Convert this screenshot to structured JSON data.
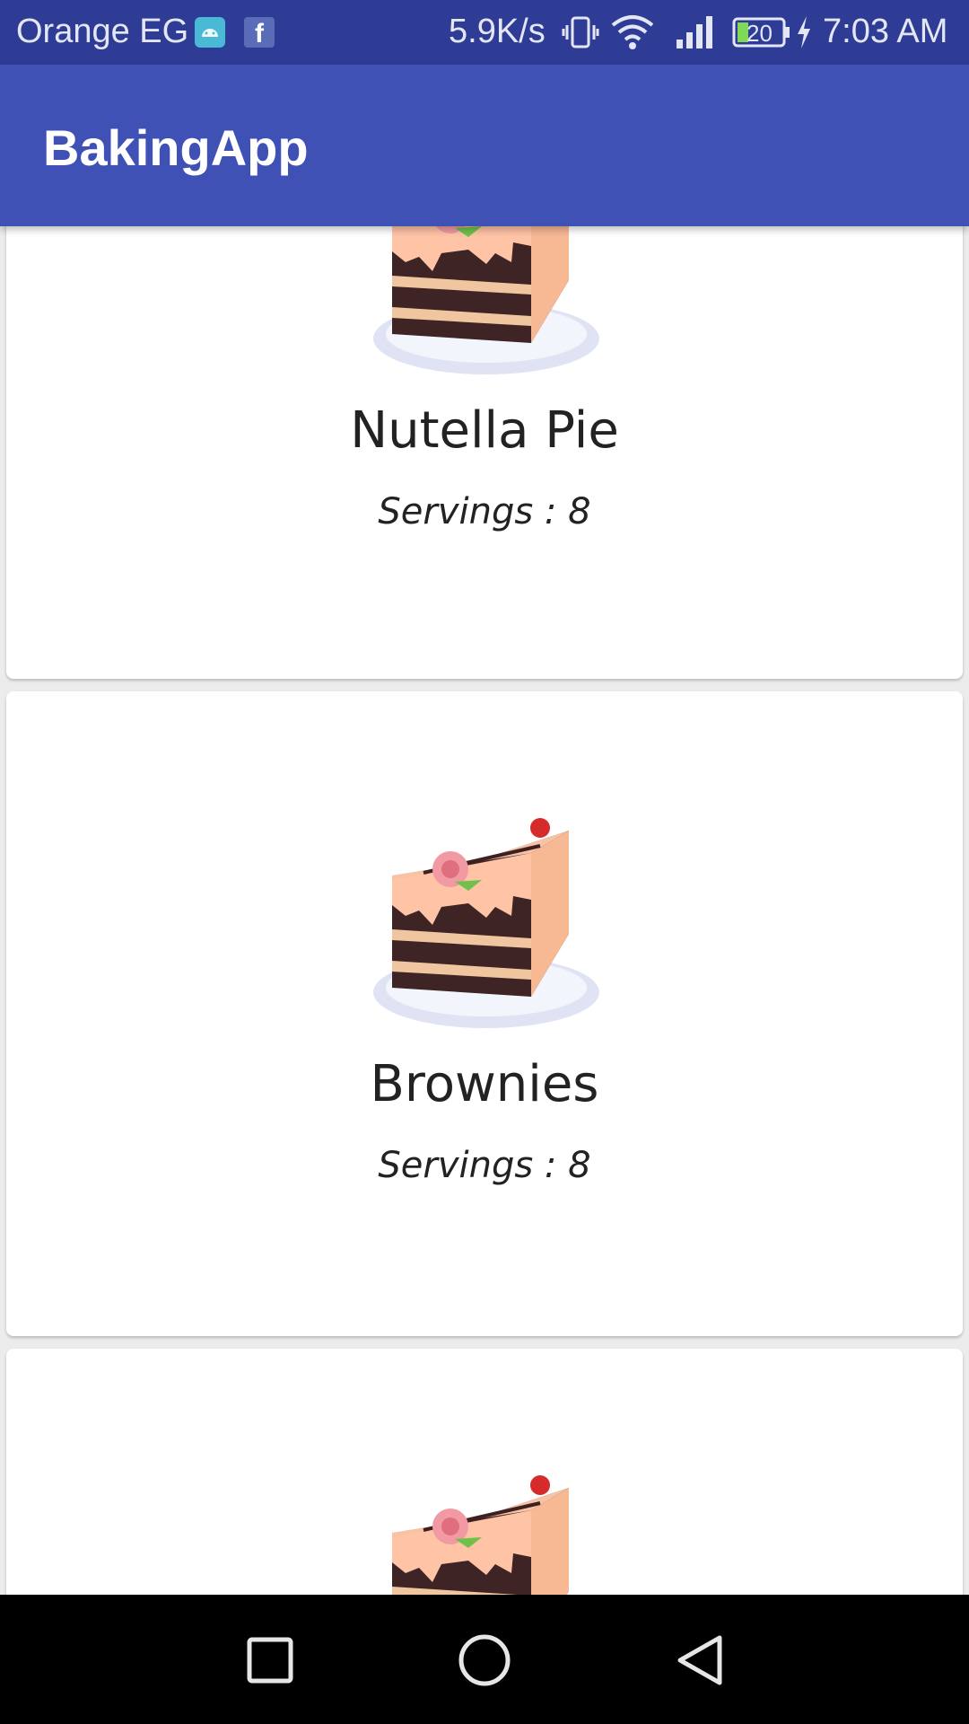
{
  "status_bar": {
    "carrier": "Orange EG",
    "network_speed": "5.9K/s",
    "battery_level": "20",
    "time": "7:03 AM",
    "icons": [
      "android-notification-icon",
      "facebook-notification-icon",
      "vibrate-icon",
      "wifi-icon",
      "signal-icon",
      "battery-icon",
      "charging-icon"
    ]
  },
  "app_bar": {
    "title": "BakingApp",
    "color": "#3f51b5"
  },
  "recipes": [
    {
      "name": "Nutella Pie",
      "servings_label": "Servings :  8"
    },
    {
      "name": "Brownies",
      "servings_label": "Servings :  8"
    },
    {
      "name": "",
      "servings_label": ""
    }
  ],
  "nav_bar": {
    "buttons": [
      "recents-button",
      "home-button",
      "back-button"
    ]
  }
}
